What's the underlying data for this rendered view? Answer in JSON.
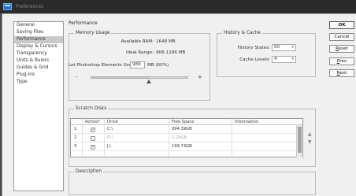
{
  "window": {
    "title": "Preferences"
  },
  "nav": {
    "items": [
      {
        "label": "General",
        "selected": false
      },
      {
        "label": "Saving Files",
        "selected": false
      },
      {
        "label": "Performance",
        "selected": true
      },
      {
        "label": "Display & Cursors",
        "selected": false
      },
      {
        "label": "Transparency",
        "selected": false
      },
      {
        "label": "Units & Rulers",
        "selected": false
      },
      {
        "label": "Guides & Grid",
        "selected": false
      },
      {
        "label": "Plug-Ins",
        "selected": false
      },
      {
        "label": "Type",
        "selected": false
      }
    ]
  },
  "performance": {
    "heading": "Performance",
    "memory": {
      "legend": "Memory Usage",
      "available_label": "Available RAM:",
      "available_value": "1648 MB",
      "ideal_label": "Ideal Range:",
      "ideal_value": "906-1186 MB",
      "let_label": "Let Photoshop Elements Use:",
      "let_value": "989",
      "let_suffix": "MB (60%)",
      "minus": "-",
      "plus": "+",
      "slider_fraction": 0.6
    },
    "history": {
      "legend": "History & Cache",
      "states_label": "History States:",
      "states_value": "50",
      "levels_label": "Cache Levels:",
      "levels_value": "4"
    },
    "scratch": {
      "legend": "Scratch Disks",
      "columns": [
        "Active?",
        "Drive",
        "Free Space",
        "Information"
      ],
      "rows": [
        {
          "num": "1",
          "active": true,
          "drive": "C:\\",
          "free": "394.39GB",
          "dim": false
        },
        {
          "num": "2",
          "active": false,
          "drive": "D:\\",
          "free": "1.29GB",
          "dim": true
        },
        {
          "num": "3",
          "active": true,
          "drive": "J:\\",
          "free": "199.74GB",
          "dim": false
        }
      ],
      "up_arrow": "▲",
      "down_arrow": "▼"
    },
    "description": {
      "legend": "Description"
    }
  },
  "buttons": {
    "ok": "OK",
    "cancel": "Cancel",
    "reset_first": "R",
    "reset_rest": "eset",
    "prev_first": "P",
    "prev_rest": "rev",
    "next_first": "N",
    "next_rest": "ext"
  },
  "colors": {
    "accent": "#1e73c8",
    "selected_nav": "#c9c9c9",
    "slider_fill": "#9ec9ff"
  }
}
